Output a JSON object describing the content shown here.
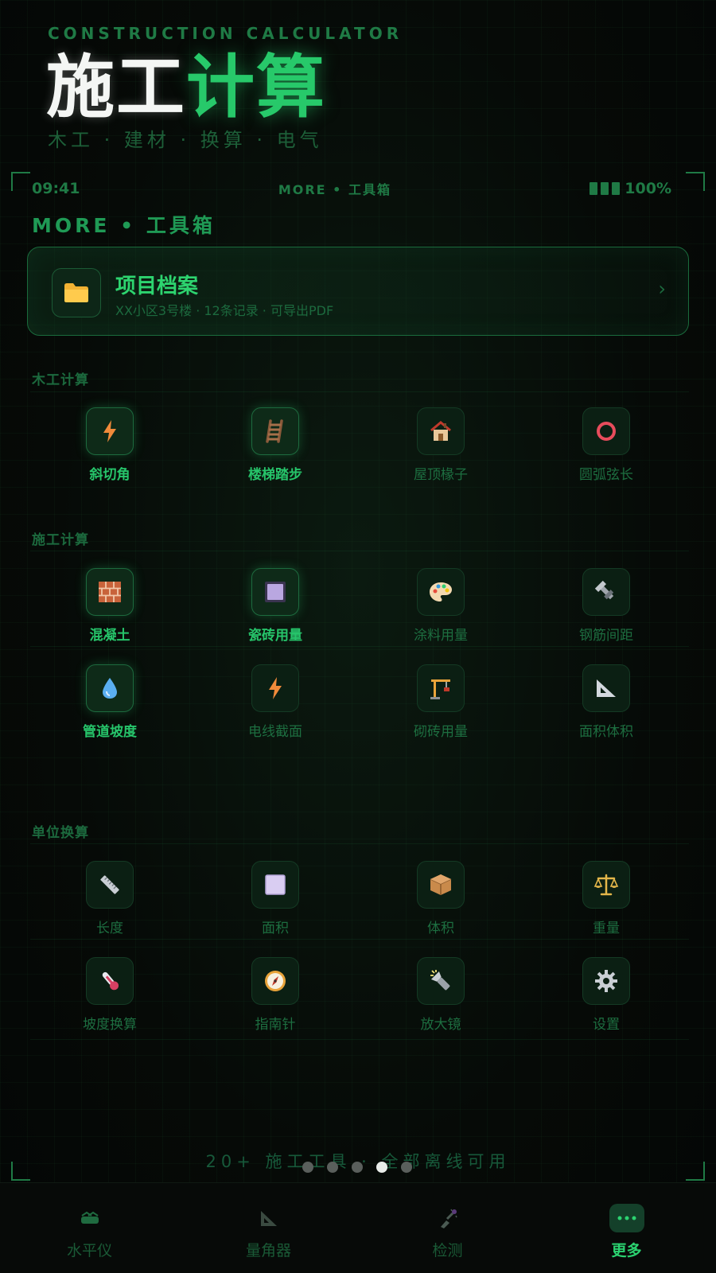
{
  "hero": {
    "subtitle_en": "CONSTRUCTION CALCULATOR",
    "title_white": "施工",
    "title_green": "计算",
    "tags": "木工 · 建材 · 换算 · 电气"
  },
  "status": {
    "time": "09:41",
    "center": "MORE • 工具箱",
    "battery": "100%"
  },
  "section_title": "MORE • 工具箱",
  "project": {
    "title": "项目档案",
    "subtitle": "XX小区3号楼 · 12条记录 · 可导出PDF",
    "chevron": "›",
    "icon": "folder-icon"
  },
  "groups": {
    "carpentry": {
      "title": "木工计算",
      "items": [
        {
          "label": "斜切角",
          "icon": "lightning-icon",
          "highlight": true
        },
        {
          "label": "楼梯踏步",
          "icon": "ladder-icon",
          "highlight": true
        },
        {
          "label": "屋顶椽子",
          "icon": "house-icon",
          "highlight": false
        },
        {
          "label": "圆弧弦长",
          "icon": "ring-icon",
          "highlight": false
        }
      ]
    },
    "construction": {
      "title": "施工计算",
      "items": [
        {
          "label": "混凝土",
          "icon": "brick-icon",
          "highlight": true
        },
        {
          "label": "瓷砖用量",
          "icon": "tile-icon",
          "highlight": true
        },
        {
          "label": "涂料用量",
          "icon": "palette-icon",
          "highlight": false
        },
        {
          "label": "钢筋间距",
          "icon": "bolt-icon",
          "highlight": false
        },
        {
          "label": "管道坡度",
          "icon": "droplet-icon",
          "highlight": true
        },
        {
          "label": "电线截面",
          "icon": "lightning-icon",
          "highlight": false
        },
        {
          "label": "砌砖用量",
          "icon": "crane-icon",
          "highlight": false
        },
        {
          "label": "面积体积",
          "icon": "triangle-ruler-icon",
          "highlight": false
        }
      ]
    },
    "units": {
      "title": "单位换算",
      "items": [
        {
          "label": "长度",
          "icon": "ruler-icon",
          "highlight": false
        },
        {
          "label": "面积",
          "icon": "square-icon",
          "highlight": false
        },
        {
          "label": "体积",
          "icon": "box-icon",
          "highlight": false
        },
        {
          "label": "重量",
          "icon": "scale-icon",
          "highlight": false
        },
        {
          "label": "坡度换算",
          "icon": "thermometer-icon",
          "highlight": false
        },
        {
          "label": "指南针",
          "icon": "compass-icon",
          "highlight": false
        },
        {
          "label": "放大镜",
          "icon": "flashlight-icon",
          "highlight": false
        },
        {
          "label": "设置",
          "icon": "gear-icon",
          "highlight": false
        }
      ]
    }
  },
  "footer": {
    "text": "20+ 施工工具 · 全部离线可用",
    "page_count": 5,
    "active_page": 4
  },
  "nav": [
    {
      "label": "水平仪",
      "icon": "level-icon",
      "active": false
    },
    {
      "label": "量角器",
      "icon": "protractor-icon",
      "active": false
    },
    {
      "label": "检测",
      "icon": "detector-icon",
      "active": false
    },
    {
      "label": "更多",
      "icon": "more-dots-icon",
      "active": true
    }
  ],
  "colors": {
    "accent": "#27c96a",
    "dim_green": "#1d6e40",
    "background": "#050806"
  }
}
